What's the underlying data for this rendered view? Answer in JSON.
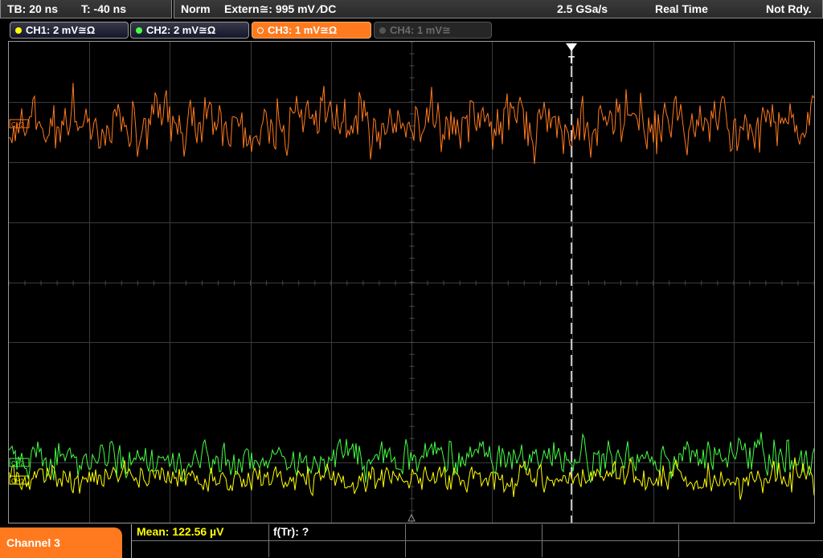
{
  "status": {
    "timebase": "TB: 20 ns",
    "trigger_time": "T: -40 ns",
    "mode": "Norm",
    "trigger_source": "Extern≅: 995 mV ⁄DC",
    "sample_rate": "2.5 GSa/s",
    "acquisition": "Real Time",
    "state": "Not Rdy."
  },
  "channels": [
    {
      "label": "CH1: 2 mV≅Ω",
      "color": "#ffff00",
      "active": true
    },
    {
      "label": "CH2: 2 mV≅Ω",
      "color": "#44ff44",
      "active": true
    },
    {
      "label": "CH3: 1 mV≅Ω",
      "color": "#ff7a1e",
      "active": true,
      "selected": true
    },
    {
      "label": "CH4: 1 mV≅",
      "color": "#555555",
      "active": false
    }
  ],
  "plot": {
    "trigger_marker": "T",
    "ch1_marker": "CH1",
    "ch2_marker": "CH2",
    "ch3_marker": "CH3"
  },
  "bottom": {
    "channel_label": "Channel 3",
    "mean": "Mean: 122.56 µV",
    "ftr": "f(Tr): ?"
  },
  "colors": {
    "grid": "#3a3a3a",
    "ch1": "#ffff00",
    "ch2": "#44ff44",
    "ch3": "#ff7a1e",
    "accent": "#ff7a1e",
    "mean_text": "#ffff00"
  }
}
